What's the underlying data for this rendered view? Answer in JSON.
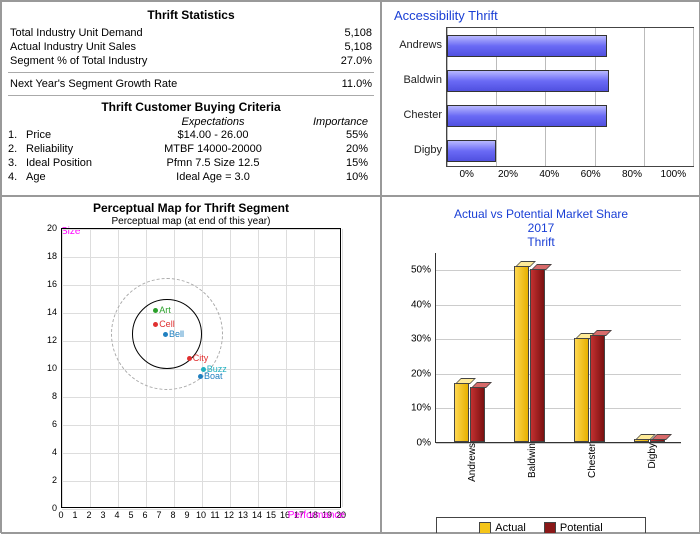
{
  "stats": {
    "title": "Thrift Statistics",
    "rows": [
      {
        "label": "Total Industry Unit Demand",
        "value": "5,108"
      },
      {
        "label": "Actual Industry Unit Sales",
        "value": "5,108"
      },
      {
        "label": "Segment % of Total Industry",
        "value": "27.0%"
      }
    ],
    "growth_row": {
      "label": "Next Year's Segment Growth Rate",
      "value": "11.0%"
    }
  },
  "criteria": {
    "title": "Thrift Customer Buying Criteria",
    "head_expectations": "Expectations",
    "head_importance": "Importance",
    "rows": [
      {
        "n": "1.",
        "name": "Price",
        "exp": "$14.00 - 26.00",
        "imp": "55%"
      },
      {
        "n": "2.",
        "name": "Reliability",
        "exp": "MTBF 14000-20000",
        "imp": "20%"
      },
      {
        "n": "3.",
        "name": "Ideal Position",
        "exp": "Pfmn 7.5 Size 12.5",
        "imp": "15%"
      },
      {
        "n": "4.",
        "name": "Age",
        "exp": "Ideal Age = 3.0",
        "imp": "10%"
      }
    ]
  },
  "accessibility": {
    "title": "Accessibility Thrift",
    "categories": [
      "Andrews",
      "Baldwin",
      "Chester",
      "Digby"
    ],
    "x_ticks": [
      "0%",
      "20%",
      "40%",
      "60%",
      "80%",
      "100%"
    ]
  },
  "pmap": {
    "title": "Perceptual Map for Thrift Segment",
    "subtitle": "Perceptual map (at end of this year)",
    "y_label": "Size",
    "x_label": "Performance",
    "products": [
      {
        "name": "Art",
        "color": "#2aa02a"
      },
      {
        "name": "Cell",
        "color": "#e03030"
      },
      {
        "name": "Bell",
        "color": "#2080c0"
      },
      {
        "name": "City",
        "color": "#e03030"
      },
      {
        "name": "Buzz",
        "color": "#20b0c0"
      },
      {
        "name": "Boat",
        "color": "#2080c0"
      }
    ]
  },
  "market": {
    "title_l1": "Actual vs Potential Market Share",
    "title_l2": "2017",
    "title_l3": "Thrift",
    "y_ticks": [
      "0%",
      "10%",
      "20%",
      "30%",
      "40%",
      "50%"
    ],
    "categories": [
      "Andrews",
      "Baldwin",
      "Chester",
      "Digby"
    ],
    "legend_actual": "Actual",
    "legend_potential": "Potential",
    "colors": {
      "actual": "#f5c519",
      "potential": "#8a1818"
    }
  },
  "chart_data": [
    {
      "type": "bar",
      "orientation": "horizontal",
      "title": "Accessibility Thrift",
      "xlabel": "",
      "ylabel": "",
      "xlim": [
        0,
        100
      ],
      "categories": [
        "Andrews",
        "Baldwin",
        "Chester",
        "Digby"
      ],
      "values": [
        65,
        66,
        65,
        20
      ]
    },
    {
      "type": "scatter",
      "title": "Perceptual Map for Thrift Segment",
      "subtitle": "Perceptual map (at end of this year)",
      "xlabel": "Performance",
      "ylabel": "Size",
      "xlim": [
        0,
        20
      ],
      "ylim": [
        0,
        20
      ],
      "ideal_center": {
        "pfmn": 7.5,
        "size": 12.5
      },
      "inner_radius": 2.5,
      "outer_radius": 4.0,
      "series": [
        {
          "name": "Art",
          "x": 6.8,
          "y": 14.2
        },
        {
          "name": "Cell",
          "x": 6.8,
          "y": 13.2
        },
        {
          "name": "Bell",
          "x": 7.5,
          "y": 12.5
        },
        {
          "name": "City",
          "x": 9.2,
          "y": 10.8
        },
        {
          "name": "Buzz",
          "x": 10.2,
          "y": 10.0
        },
        {
          "name": "Boat",
          "x": 10.0,
          "y": 9.5
        }
      ]
    },
    {
      "type": "bar",
      "title": "Actual vs Potential Market Share 2017 Thrift",
      "xlabel": "",
      "ylabel": "",
      "ylim": [
        0,
        55
      ],
      "categories": [
        "Andrews",
        "Baldwin",
        "Chester",
        "Digby"
      ],
      "series": [
        {
          "name": "Actual",
          "values": [
            17,
            51,
            30,
            1
          ]
        },
        {
          "name": "Potential",
          "values": [
            16,
            50,
            31,
            1
          ]
        }
      ]
    }
  ]
}
